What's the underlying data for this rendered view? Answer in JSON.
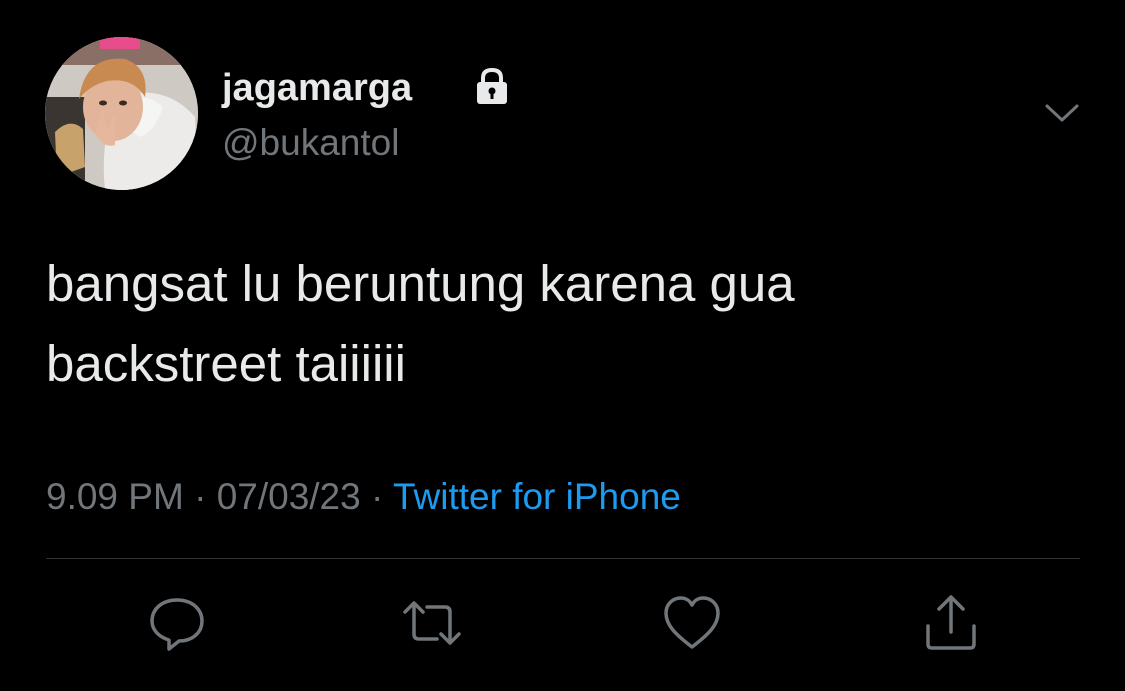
{
  "user": {
    "display_name": "jagamarga",
    "handle": "@bukantol",
    "protected_icon": "lock-icon",
    "avatar": "profile-photo"
  },
  "tweet": {
    "text_lines": [
      "bangsat lu beruntung karena gua",
      "backstreet taiiiiii"
    ]
  },
  "meta": {
    "time": "9.09 PM",
    "separator": "·",
    "date": "07/03/23",
    "source": "Twitter for iPhone"
  },
  "actions": [
    "reply-icon",
    "retweet-icon",
    "like-icon",
    "share-icon"
  ],
  "colors": {
    "background": "#000000",
    "text_primary": "#e7e9ea",
    "text_secondary": "#71767b",
    "link": "#1d9bf0",
    "divider": "#2f3336"
  }
}
